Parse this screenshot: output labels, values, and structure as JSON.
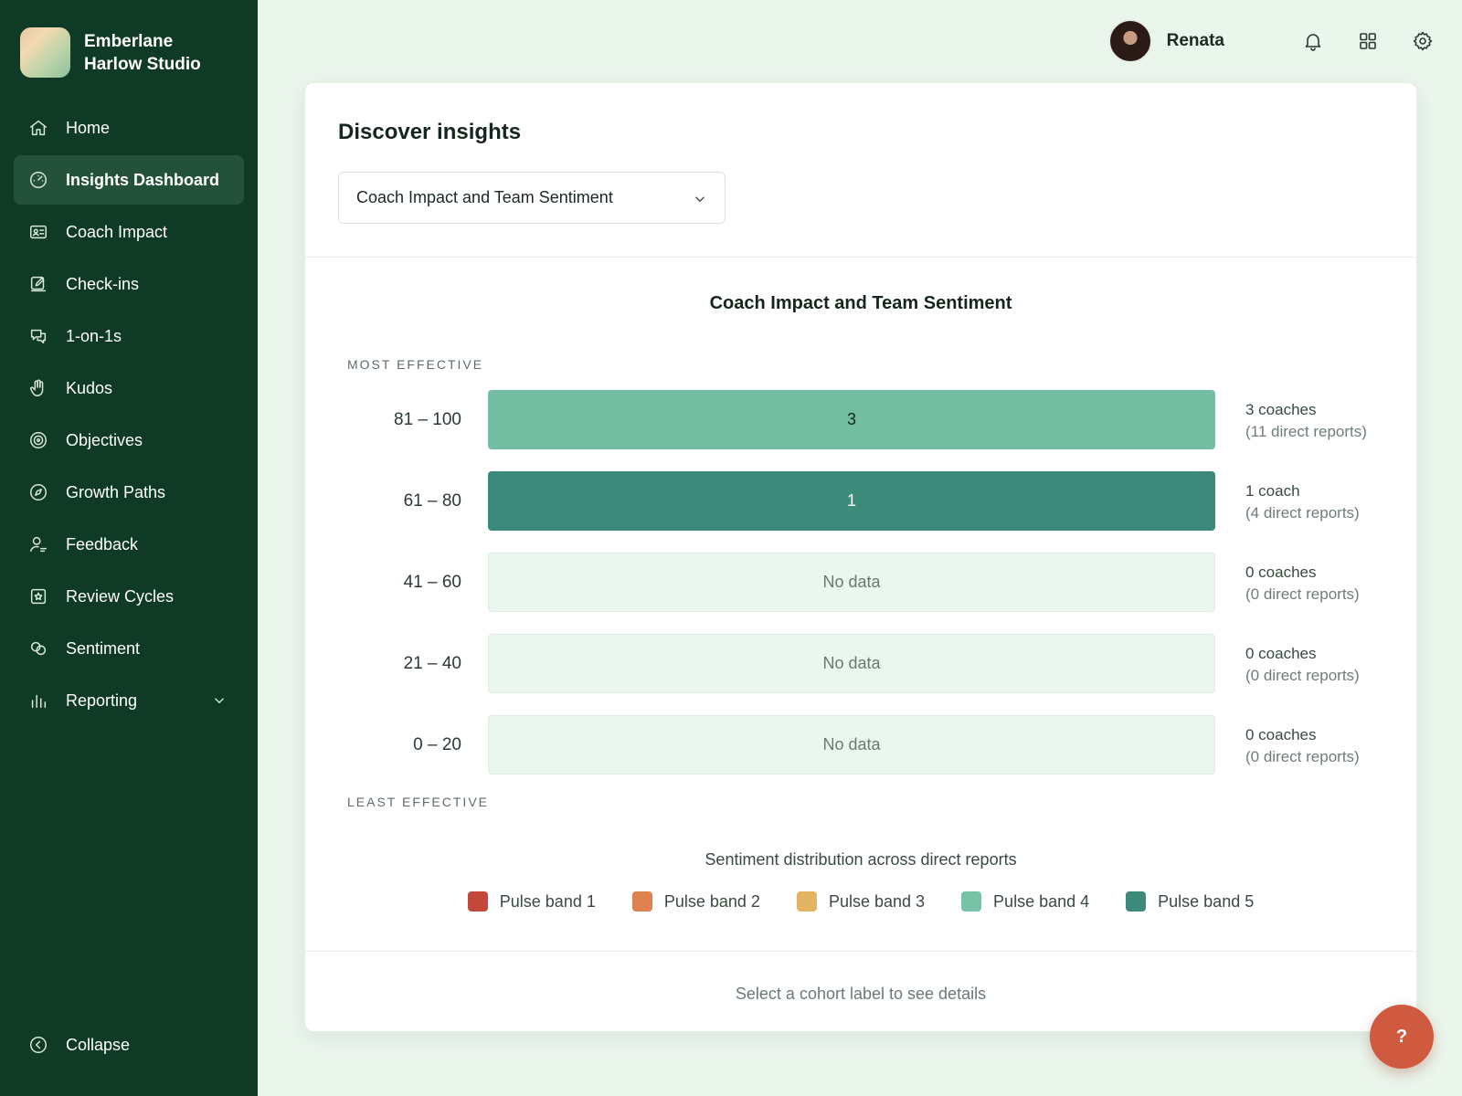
{
  "brand": {
    "name_line1": "Emberlane",
    "name_line2": "Harlow Studio"
  },
  "sidebar": {
    "items": [
      {
        "label": "Home",
        "icon": "home-icon"
      },
      {
        "label": "Insights Dashboard",
        "icon": "dashboard-icon",
        "active": true
      },
      {
        "label": "Coach Impact",
        "icon": "id-card-icon"
      },
      {
        "label": "Check-ins",
        "icon": "edit-icon"
      },
      {
        "label": "1-on-1s",
        "icon": "chat-icon"
      },
      {
        "label": "Kudos",
        "icon": "hand-icon"
      },
      {
        "label": "Objectives",
        "icon": "target-icon"
      },
      {
        "label": "Growth Paths",
        "icon": "compass-icon"
      },
      {
        "label": "Feedback",
        "icon": "user-feedback-icon"
      },
      {
        "label": "Review Cycles",
        "icon": "star-box-icon"
      },
      {
        "label": "Sentiment",
        "icon": "sentiment-icon"
      },
      {
        "label": "Reporting",
        "icon": "bar-chart-icon",
        "expandable": true
      }
    ],
    "collapse_label": "Collapse"
  },
  "topbar": {
    "username": "Renata"
  },
  "card": {
    "title": "Discover insights",
    "select_value": "Coach Impact and Team Sentiment"
  },
  "chart_data": {
    "type": "bar",
    "title": "Coach Impact and Team Sentiment",
    "axis_top": "MOST EFFECTIVE",
    "axis_bottom": "LEAST EFFECTIVE",
    "categories": [
      "81 – 100",
      "61 – 80",
      "41 – 60",
      "21 – 40",
      "0 – 20"
    ],
    "values": [
      3,
      1,
      0,
      0,
      0
    ],
    "bar_labels": [
      "3",
      "1",
      "No data",
      "No data",
      "No data"
    ],
    "coach_counts": [
      "3 coaches",
      "1 coach",
      "0 coaches",
      "0 coaches",
      "0 coaches"
    ],
    "report_counts": [
      "(11 direct reports)",
      "(4 direct reports)",
      "(0 direct reports)",
      "(0 direct reports)",
      "(0 direct reports)"
    ],
    "bar_colors": [
      "#73bea3",
      "#3c8a79",
      "#eaf6ee",
      "#eaf6ee",
      "#eaf6ee"
    ],
    "distribution_title": "Sentiment distribution across direct reports",
    "legend": [
      {
        "name": "Pulse band 1",
        "color": "#c2483c"
      },
      {
        "name": "Pulse band 2",
        "color": "#e0824f"
      },
      {
        "name": "Pulse band 3",
        "color": "#e3b562"
      },
      {
        "name": "Pulse band 4",
        "color": "#76c3a7"
      },
      {
        "name": "Pulse band 5",
        "color": "#3c8a79"
      }
    ]
  },
  "footer_hint": "Select a cohort label to see details",
  "help_label": "?"
}
